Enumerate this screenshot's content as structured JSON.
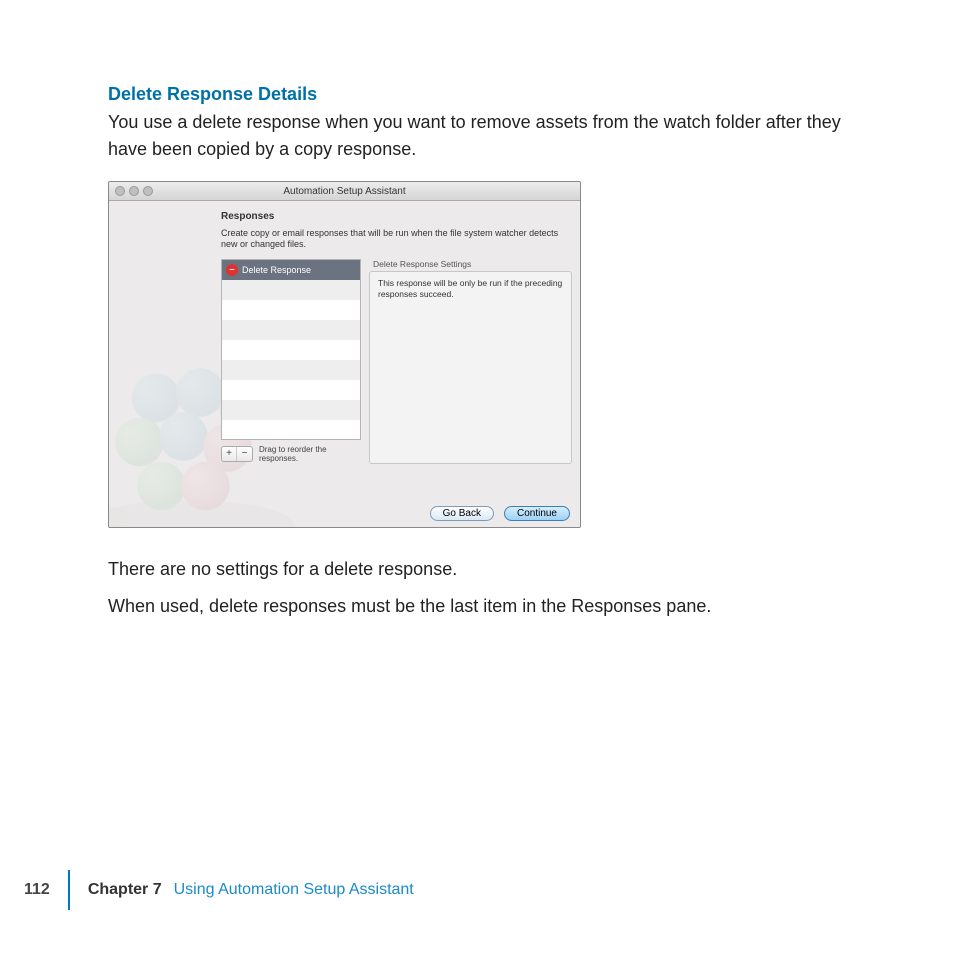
{
  "heading": "Delete Response Details",
  "intro": "You use a delete response when you want to remove assets from the watch folder after they have been copied by a copy response.",
  "after1": "There are no settings for a delete response.",
  "after2": "When used, delete responses must be the last item in the Responses pane.",
  "dialog": {
    "title": "Automation Setup Assistant",
    "section_label": "Responses",
    "section_desc": "Create copy or email responses that will be run when the file system watcher detects new or changed files.",
    "list_item": "Delete Response",
    "reorder_hint": "Drag to reorder the responses.",
    "settings_title": "Delete Response Settings",
    "settings_body": "This response will be only be run if the preceding responses succeed.",
    "back": "Go Back",
    "continue": "Continue",
    "plus": "+",
    "minus": "−"
  },
  "footer": {
    "page_number": "112",
    "chapter_label": "Chapter 7",
    "chapter_title": "Using Automation Setup Assistant"
  }
}
